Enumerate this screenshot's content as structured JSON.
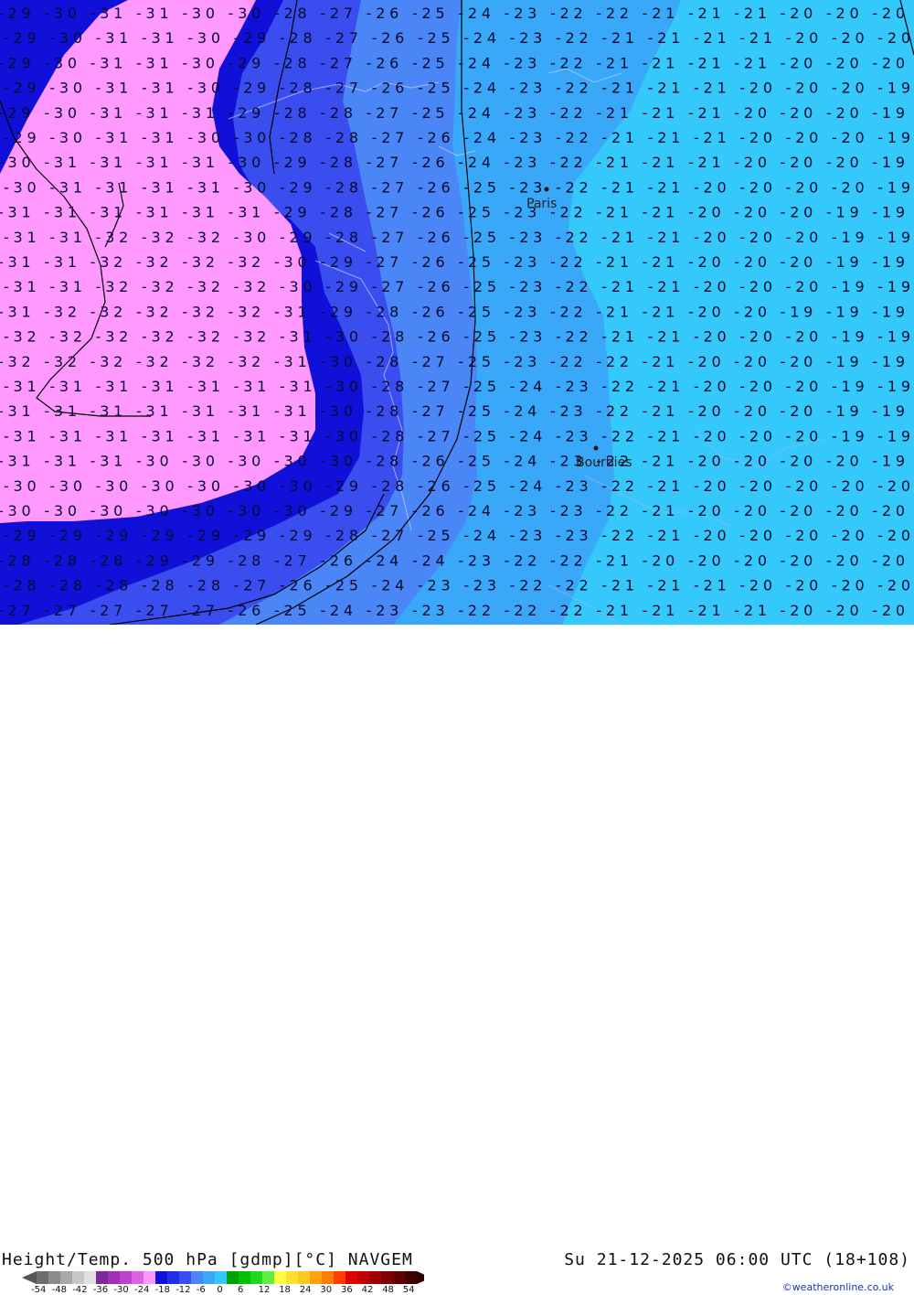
{
  "map": {
    "title": "Height/Temp. 500 hPa [gdmp][°C] NAVGEM",
    "valid_time": "Su 21-12-2025 06:00 UTC (18+108)",
    "credit": "©weatheronline.co.uk",
    "cities": [
      {
        "name": "Paris",
        "id": "city-paris"
      },
      {
        "name": "Bourbies",
        "id": "city-bourbies"
      }
    ],
    "temperature_rows": [
      "-29 -30 -31 -31 -30 -30 -28 -27 -26 -25 -24 -23 -22 -22 -21 -21 -21 -20 -20 -20",
      "-29 -30 -31 -31 -30 -29 -28 -27 -26 -25 -24 -23 -22 -21 -21 -21 -21 -20 -20 -20",
      "-29 -30 -31 -31 -30 -29 -28 -27 -26 -25 -24 -23 -22 -21 -21 -21 -21 -20 -20 -20",
      "-29 -30 -31 -31 -30 -29 -28 -27 -26 -25 -24 -23 -22 -21 -21 -21 -20 -20 -20 -19",
      "-29 -30 -31 -31 -31 -29 -28 -28 -27 -25 -24 -23 -22 -21 -21 -21 -20 -20 -20 -19",
      "-29 -30 -31 -31 -30 -30 -28 -28 -27 -26 -24 -23 -22 -21 -21 -21 -20 -20 -20 -19",
      "-30 -31 -31 -31 -31 -30 -29 -28 -27 -26 -24 -23 -22 -21 -21 -21 -20 -20 -20 -19",
      "-30 -31 -31 -31 -31 -30 -29 -28 -27 -26 -25 -23 -22 -21 -21 -20 -20 -20 -20 -19",
      "-31 -31 -31 -31 -31 -31 -29 -28 -27 -26 -25 -23 -22 -21 -21 -20 -20 -20 -19 -19",
      "-31 -31 -32 -32 -32 -30 -29 -28 -27 -26 -25 -23 -22 -21 -21 -20 -20 -20 -19 -19",
      "-31 -31 -32 -32 -32 -32 -30 -29 -27 -26 -25 -23 -22 -21 -21 -20 -20 -20 -19 -19",
      "-31 -31 -32 -32 -32 -32 -30 -29 -27 -26 -25 -23 -22 -21 -21 -20 -20 -20 -19 -19",
      "-31 -32 -32 -32 -32 -32 -31 -29 -28 -26 -25 -23 -22 -21 -21 -20 -20 -19 -19 -19",
      "-32 -32 -32 -32 -32 -32 -31 -30 -28 -26 -25 -23 -22 -21 -21 -20 -20 -20 -19 -19",
      "-32 -32 -32 -32 -32 -32 -31 -30 -28 -27 -25 -23 -22 -22 -21 -20 -20 -20 -19 -19",
      "-31 -31 -31 -31 -31 -31 -31 -30 -28 -27 -25 -24 -23 -22 -21 -20 -20 -20 -19 -19",
      "-31 -31 -31 -31 -31 -31 -31 -30 -28 -27 -25 -24 -23 -22 -21 -20 -20 -20 -19 -19",
      "-31 -31 -31 -31 -31 -31 -31 -30 -28 -27 -25 -24 -23 -22 -21 -20 -20 -20 -19 -19",
      "-31 -31 -31 -30 -30 -30 -30 -30 -28 -26 -25 -24 -23 -22 -21 -20 -20 -20 -20 -19",
      "-30 -30 -30 -30 -30 -30 -30 -29 -28 -26 -25 -24 -23 -22 -21 -20 -20 -20 -20 -20",
      "-30 -30 -30 -30 -30 -30 -30 -29 -27 -26 -24 -23 -23 -22 -21 -20 -20 -20 -20 -20",
      "-29 -29 -29 -29 -29 -29 -29 -28 -27 -25 -24 -23 -23 -22 -21 -20 -20 -20 -20 -20",
      "-28 -28 -28 -29 -29 -28 -27 -26 -24 -24 -23 -22 -22 -21 -20 -20 -20 -20 -20 -20",
      "-28 -28 -28 -28 -28 -27 -26 -25 -24 -23 -23 -22 -22 -21 -21 -21 -20 -20 -20 -20",
      "-27 -27 -27 -27 -27 -26 -25 -24 -23 -23 -22 -22 -22 -21 -21 -21 -21 -20 -20 -20"
    ],
    "temperature_bands": [
      {
        "range": "-32 and below",
        "color": "#ff99ff"
      },
      {
        "range": "-31 to -28",
        "color": "#1010d8"
      },
      {
        "range": "-27 to -26",
        "color": "#3a4ef0"
      },
      {
        "range": "-25 to -24",
        "color": "#4a86f5"
      },
      {
        "range": "-23 to -22",
        "color": "#3aa8f8"
      },
      {
        "range": "-21 and above",
        "color": "#35c8fb"
      }
    ]
  },
  "legend": {
    "ticks": [
      "-54",
      "-48",
      "-42",
      "-36",
      "-30",
      "-24",
      "-18",
      "-12",
      "-6",
      "0",
      "6",
      "12",
      "18",
      "24",
      "30",
      "36",
      "42",
      "48",
      "54"
    ],
    "colors": [
      "#6e6e6e",
      "#8c8c8c",
      "#a8a8a8",
      "#c8c8c8",
      "#e0e0e0",
      "#7a2a9a",
      "#a030b8",
      "#c040d0",
      "#e060e8",
      "#ff99ff",
      "#1010d8",
      "#2030e8",
      "#3a4ef0",
      "#4a86f5",
      "#3aa8f8",
      "#35c8fb",
      "#00a000",
      "#00c000",
      "#20d820",
      "#60ee40",
      "#ffff40",
      "#ffe030",
      "#ffc820",
      "#ffa010",
      "#ff8000",
      "#ff4000",
      "#e00000",
      "#c00000",
      "#a00000",
      "#800000",
      "#600000",
      "#400000"
    ]
  }
}
